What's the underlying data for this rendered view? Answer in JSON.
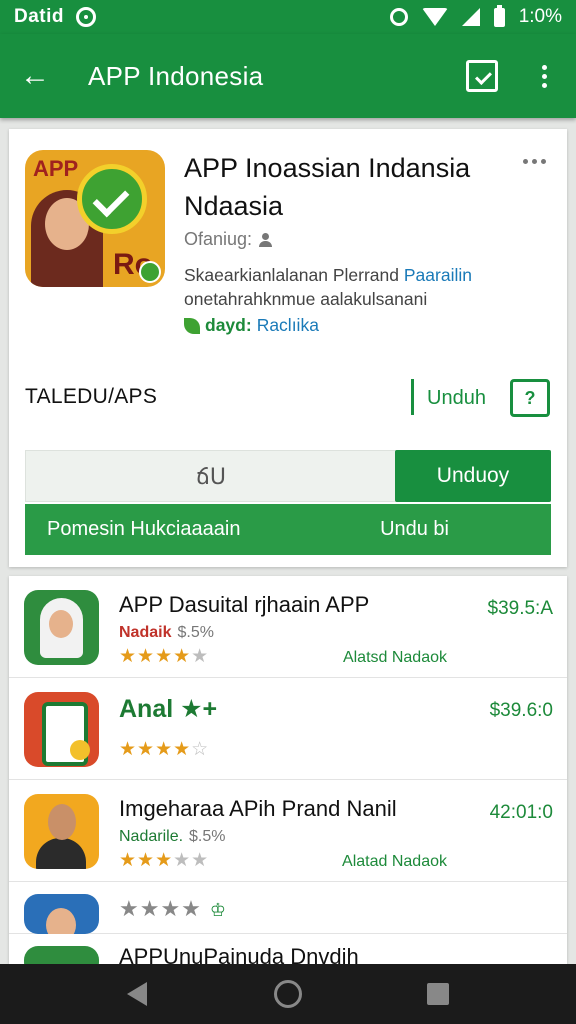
{
  "status_bar": {
    "carrier": "Datid",
    "battery": "1:0%"
  },
  "toolbar": {
    "title": "APP Indonesia"
  },
  "app": {
    "title": "APP Inoassian Indansia Ndaasia",
    "icon_label": "APP",
    "icon_letters": "Ro",
    "meta_label": "Ofaniug:",
    "description_plain": "Skaearkianlalanan Plerrand",
    "description_link": "Paarailin",
    "description_line2": "onetahrahknmue aalakulsanani",
    "developer_label": "dayd:",
    "developer_name": "Raclıika"
  },
  "install_section": {
    "label": "TALEDU/APS",
    "side_unduh": "Unduh",
    "side_icon": "?",
    "count": "ճՍ",
    "download_button": "Unduoy",
    "promo_text": "Pomesin Hukciaaaain",
    "promo_action": "Undu bi"
  },
  "list": [
    {
      "name": "APP Dasuital rjhaain APP",
      "price": "$39.5:A",
      "sub_red": "Nadaik",
      "sub_grey": "$.5%",
      "rating": 4,
      "extra": "Alatsd Nadaok"
    },
    {
      "name": "Anal ★+",
      "price": "$39.6:0",
      "rating": 4
    },
    {
      "name": "Imgeharaa APih Prand Nanil",
      "price": "42:01:0",
      "sub_red": "Nadarile.",
      "sub_grey": "$.5%",
      "rating": 3.5,
      "extra": "Alatad Nadaok"
    },
    {
      "name": "",
      "rating": 4,
      "verify": "♔"
    },
    {
      "name": "APPUnuPainuda Dnvdih"
    }
  ],
  "colors": {
    "primary": "#188f3f",
    "accent": "#2a9b47",
    "star": "#e59b1a"
  },
  "icons": [
    "back-arrow-icon",
    "update-icon",
    "more-vert-icon",
    "person-icon",
    "leaf-icon",
    "star-icon"
  ]
}
